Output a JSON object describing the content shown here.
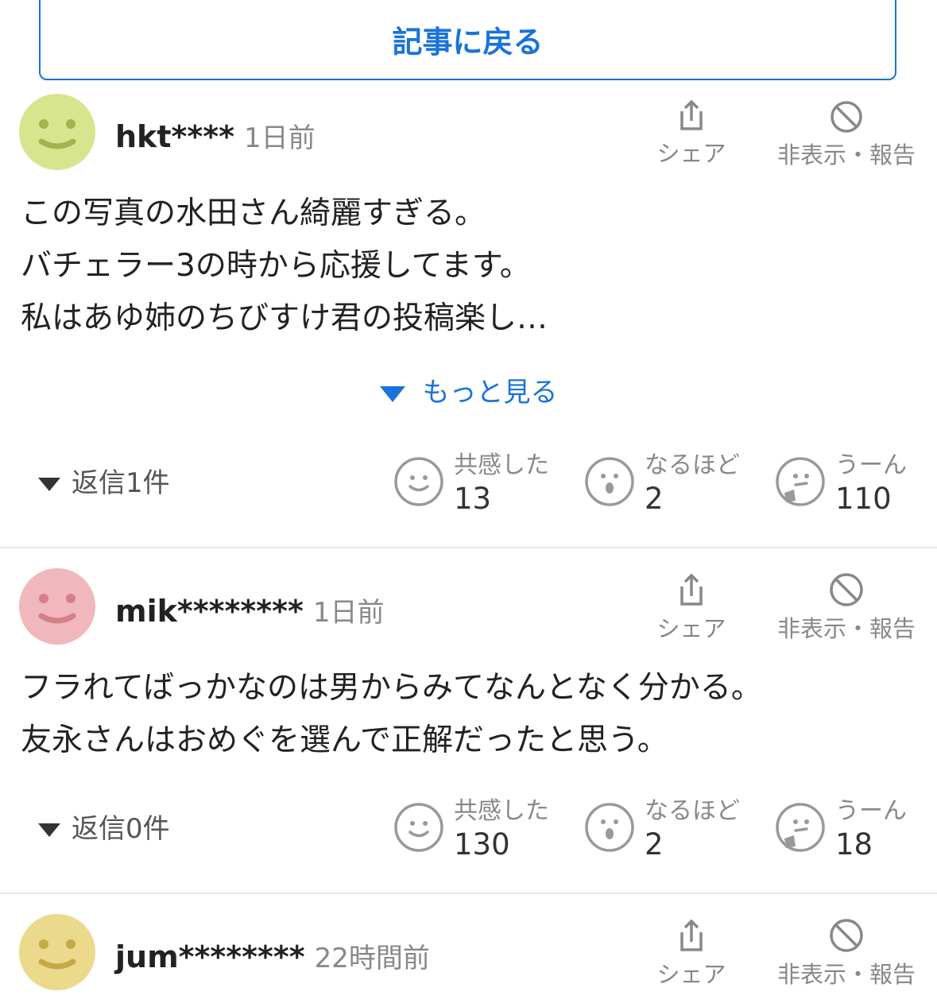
{
  "back_button": "記事に戻る",
  "labels": {
    "share": "シェア",
    "report": "非表示・報告",
    "more": "もっと見る",
    "empathize": "共感した",
    "naruhodo": "なるほど",
    "uun": "うーん"
  },
  "comments": [
    {
      "username": "hkt****",
      "time": "1日前",
      "avatar_color": "#d7e58f",
      "lines": [
        "この写真の水田さん綺麗すぎる。",
        "バチェラー3の時から応援してます。",
        "私はあゆ姉のちびすけ君の投稿楽し…"
      ],
      "reply": "返信1件",
      "empathize_count": "13",
      "naruhodo_count": "2",
      "uun_count": "110"
    },
    {
      "username": "mik********",
      "time": "1日前",
      "avatar_color": "#f0b7bd",
      "lines": [
        "フラれてばっかなのは男からみてなんとなく分かる。",
        "友永さんはおめぐを選んで正解だったと思う。"
      ],
      "reply": "返信0件",
      "empathize_count": "130",
      "naruhodo_count": "2",
      "uun_count": "18"
    },
    {
      "username": "jum********",
      "time": "22時間前",
      "avatar_color": "#ebd98c"
    }
  ]
}
